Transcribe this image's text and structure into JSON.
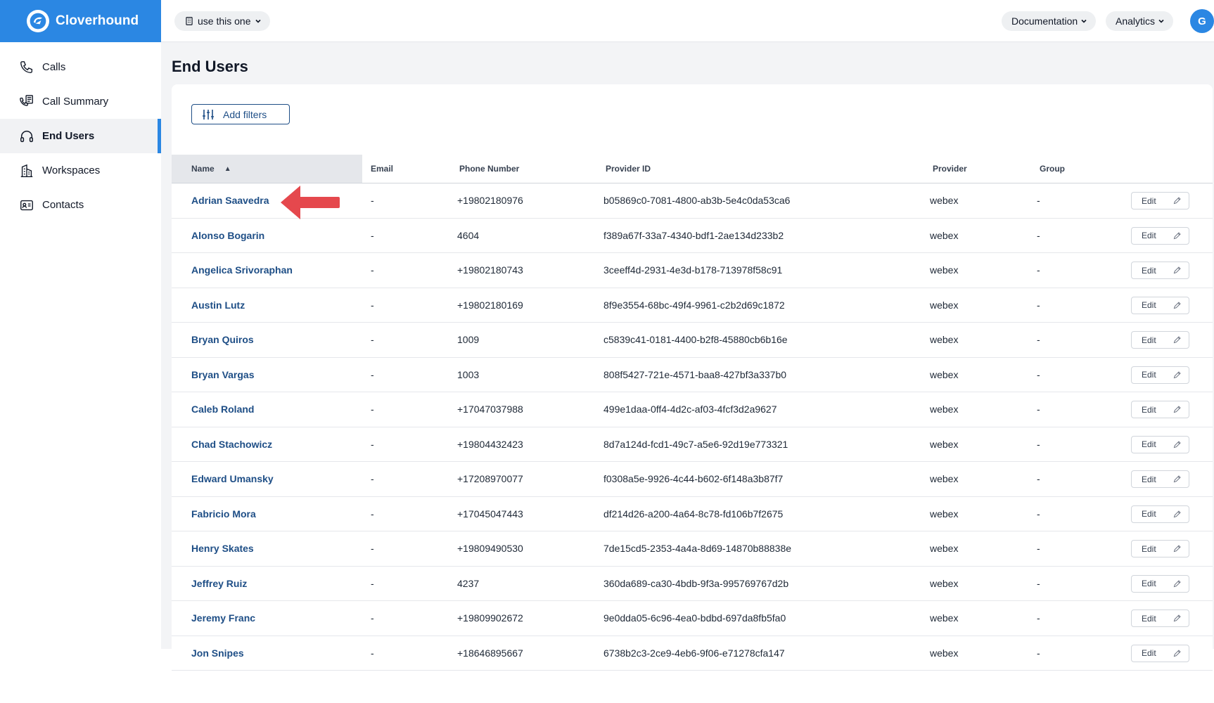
{
  "brand": {
    "name": "Cloverhound"
  },
  "sidebar": {
    "items": [
      {
        "label": "Calls",
        "icon": "phone-icon"
      },
      {
        "label": "Call Summary",
        "icon": "call-summary-icon"
      },
      {
        "label": "End Users",
        "icon": "headset-icon",
        "active": true
      },
      {
        "label": "Workspaces",
        "icon": "building-icon"
      },
      {
        "label": "Contacts",
        "icon": "contact-card-icon"
      }
    ]
  },
  "topbar": {
    "workspace_label": "use this one",
    "documentation_label": "Documentation",
    "analytics_label": "Analytics",
    "avatar_initial": "G"
  },
  "page": {
    "title": "End Users",
    "filter_button": "Add filters"
  },
  "table": {
    "columns": [
      "Name",
      "Email",
      "Phone Number",
      "Provider ID",
      "Provider",
      "Group"
    ],
    "sort_indicator": "▲",
    "edit_label": "Edit",
    "rows": [
      {
        "name": "Adrian Saavedra",
        "email": "-",
        "phone": "+19802180976",
        "provider_id": "b05869c0-7081-4800-ab3b-5e4c0da53ca6",
        "provider": "webex",
        "group": "-"
      },
      {
        "name": "Alonso Bogarin",
        "email": "-",
        "phone": "4604",
        "provider_id": "f389a67f-33a7-4340-bdf1-2ae134d233b2",
        "provider": "webex",
        "group": "-"
      },
      {
        "name": "Angelica Srivoraphan",
        "email": "-",
        "phone": "+19802180743",
        "provider_id": "3ceeff4d-2931-4e3d-b178-713978f58c91",
        "provider": "webex",
        "group": "-"
      },
      {
        "name": "Austin Lutz",
        "email": "-",
        "phone": "+19802180169",
        "provider_id": "8f9e3554-68bc-49f4-9961-c2b2d69c1872",
        "provider": "webex",
        "group": "-"
      },
      {
        "name": "Bryan Quiros",
        "email": "-",
        "phone": "1009",
        "provider_id": "c5839c41-0181-4400-b2f8-45880cb6b16e",
        "provider": "webex",
        "group": "-"
      },
      {
        "name": "Bryan Vargas",
        "email": "-",
        "phone": "1003",
        "provider_id": "808f5427-721e-4571-baa8-427bf3a337b0",
        "provider": "webex",
        "group": "-"
      },
      {
        "name": "Caleb Roland",
        "email": "-",
        "phone": "+17047037988",
        "provider_id": "499e1daa-0ff4-4d2c-af03-4fcf3d2a9627",
        "provider": "webex",
        "group": "-"
      },
      {
        "name": "Chad Stachowicz",
        "email": "-",
        "phone": "+19804432423",
        "provider_id": "8d7a124d-fcd1-49c7-a5e6-92d19e773321",
        "provider": "webex",
        "group": "-"
      },
      {
        "name": "Edward Umansky",
        "email": "-",
        "phone": "+17208970077",
        "provider_id": "f0308a5e-9926-4c44-b602-6f148a3b87f7",
        "provider": "webex",
        "group": "-"
      },
      {
        "name": "Fabricio Mora",
        "email": "-",
        "phone": "+17045047443",
        "provider_id": "df214d26-a200-4a64-8c78-fd106b7f2675",
        "provider": "webex",
        "group": "-"
      },
      {
        "name": "Henry Skates",
        "email": "-",
        "phone": "+19809490530",
        "provider_id": "7de15cd5-2353-4a4a-8d69-14870b88838e",
        "provider": "webex",
        "group": "-"
      },
      {
        "name": "Jeffrey Ruiz",
        "email": "-",
        "phone": "4237",
        "provider_id": "360da689-ca30-4bdb-9f3a-995769767d2b",
        "provider": "webex",
        "group": "-"
      },
      {
        "name": "Jeremy Franc",
        "email": "-",
        "phone": "+19809902672",
        "provider_id": "9e0dda05-6c96-4ea0-bdbd-697da8fb5fa0",
        "provider": "webex",
        "group": "-"
      },
      {
        "name": "Jon Snipes",
        "email": "-",
        "phone": "+18646895667",
        "provider_id": "6738b2c3-2ce9-4eb6-9f06-e71278cfa147",
        "provider": "webex",
        "group": "-"
      }
    ]
  },
  "colors": {
    "brand": "#2b87e3",
    "link": "#1e4e86",
    "annotation_arrow": "#e5484d"
  }
}
